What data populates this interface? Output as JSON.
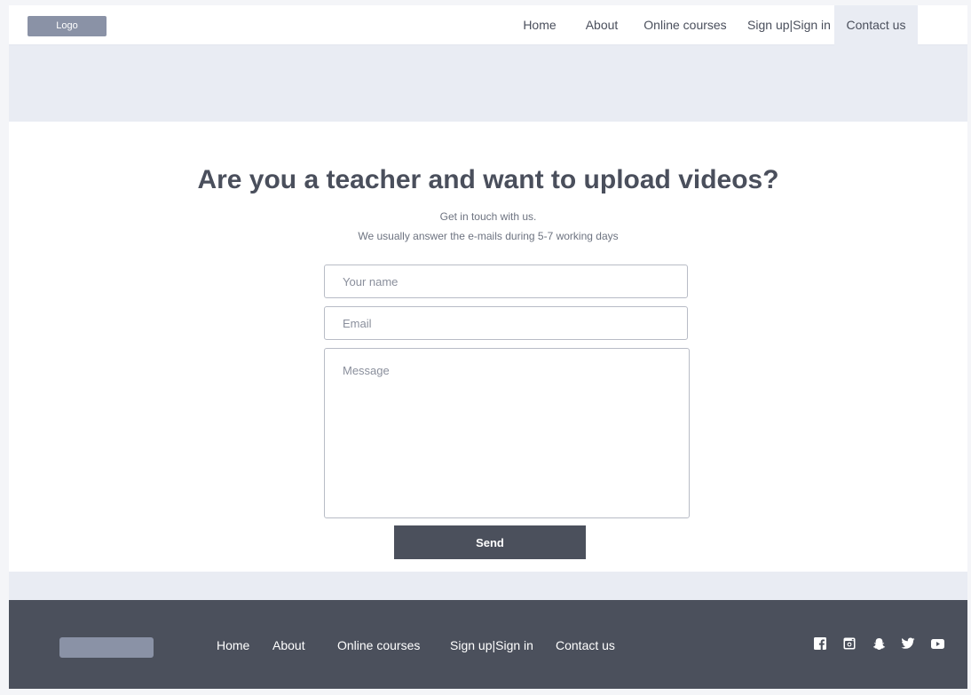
{
  "header": {
    "logo_label": "Logo",
    "nav": [
      {
        "label": "Home"
      },
      {
        "label": "About"
      },
      {
        "label": "Online courses"
      },
      {
        "label": "Sign up|Sign in"
      },
      {
        "label": "Contact us",
        "active": true
      }
    ]
  },
  "main": {
    "title": "Are you a teacher and want to upload videos?",
    "subtitle_line1": "Get in touch with us.",
    "subtitle_line2": "We usually answer the e-mails during 5-7 working days",
    "form": {
      "name_placeholder": "Your name",
      "email_placeholder": "Email",
      "message_placeholder": "Message",
      "send_label": "Send"
    }
  },
  "footer": {
    "links": [
      {
        "label": "Home"
      },
      {
        "label": "About"
      },
      {
        "label": "Online courses"
      },
      {
        "label": "Sign up|Sign in"
      },
      {
        "label": "Contact us"
      }
    ],
    "social_icons": [
      "facebook-icon",
      "instagram-icon",
      "snapchat-icon",
      "twitter-icon",
      "youtube-icon"
    ]
  },
  "colors": {
    "accent": "#4b505c",
    "nav_active_bg": "#e9ecf3",
    "logo_placeholder": "#8a92a6",
    "footer_bg": "#4b505c"
  }
}
